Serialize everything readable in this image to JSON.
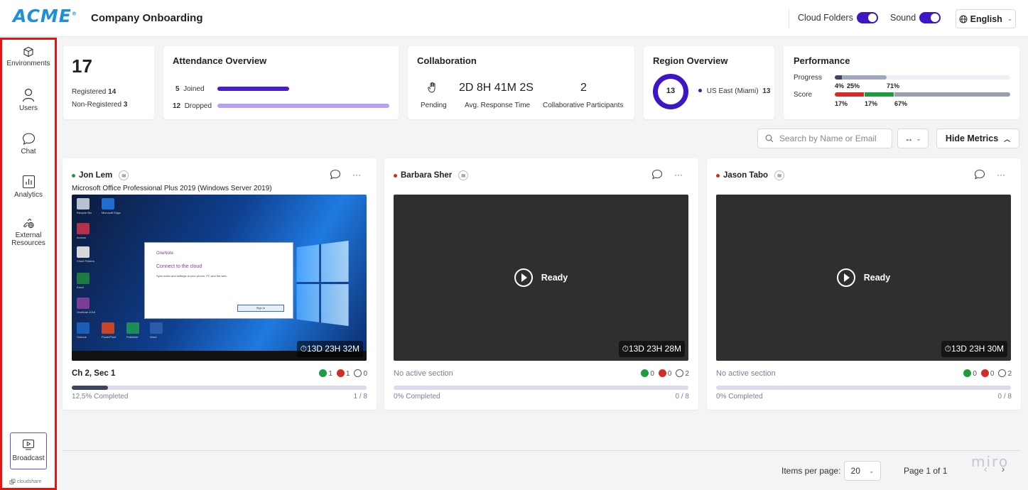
{
  "header": {
    "logo": "ACME",
    "logo_mark": "®",
    "title": "Company Onboarding",
    "cloud_folders_label": "Cloud Folders",
    "sound_label": "Sound",
    "language": "English",
    "accent_color": "#3d16c8"
  },
  "sidebar": {
    "items": [
      {
        "label": "Environments",
        "icon": "cube-icon"
      },
      {
        "label": "Users",
        "icon": "user-icon"
      },
      {
        "label": "Chat",
        "icon": "chat-bubble-icon"
      },
      {
        "label": "Analytics",
        "icon": "bar-chart-icon"
      },
      {
        "label": "External",
        "label2": "Resources",
        "icon": "link-globe-icon"
      }
    ],
    "broadcast_label": "Broadcast",
    "brand": "cloudshare",
    "highlight_color": "#e21515"
  },
  "metrics": {
    "total": "17",
    "registered_label": "Registered",
    "registered": "14",
    "non_registered_label": "Non-Registered",
    "non_registered": "3",
    "attendance": {
      "title": "Attendance Overview",
      "joined_count": "5",
      "joined_label": "Joined",
      "dropped_count": "12",
      "dropped_label": "Dropped"
    },
    "collaboration": {
      "title": "Collaboration",
      "pending_label": "Pending",
      "avg_response": "2D 8H 41M 2S",
      "avg_response_label": "Avg. Response Time",
      "participants": "2",
      "participants_label": "Collaborative Participants"
    },
    "region": {
      "title": "Region Overview",
      "total": "13",
      "region_name": "US East (Miami)",
      "region_count": "13"
    },
    "performance": {
      "title": "Performance",
      "progress_label": "Progress",
      "score_label": "Score",
      "progress_values": [
        "4%",
        "25%",
        "71%"
      ],
      "score_values": [
        "17%",
        "17%",
        "67%"
      ],
      "progress_fractions": [
        0.04,
        0.25,
        0.71
      ],
      "score_fractions": [
        0.17,
        0.17,
        0.67
      ]
    }
  },
  "toolbar": {
    "search_placeholder": "Search by Name or Email",
    "swap_label": "↔",
    "hide_metrics_label": "Hide Metrics"
  },
  "users": [
    {
      "name": "Jon Lem",
      "status_color": "#1f9c3f",
      "subtitle": "Microsoft Office Professional Plus 2019 (Windows Server 2019)",
      "screen": "desktop",
      "timer": "13D 23H 32M",
      "section": "Ch 2, Sec 1",
      "ok": "1",
      "err": "1",
      "pending": "0",
      "progress_label": "12.5% Completed",
      "progress_fraction": 0.125,
      "count": "1 / 8",
      "desktop": {
        "dialog_app": "OneNote",
        "dialog_title": "Connect to the cloud",
        "dialog_body": "Sync notes and settings to your phone, PC and the web.",
        "dialog_button": "Sign In",
        "icons": [
          "Recycle Bin",
          "Microsoft Edge",
          "Access",
          "Cloud Folders",
          "Excel",
          "OneNote 2016",
          "Outlook",
          "PowerPoint",
          "Publisher",
          "Word"
        ]
      }
    },
    {
      "name": "Barbara Sher",
      "status_color": "#d42a2a",
      "screen": "ready",
      "ready_label": "Ready",
      "timer": "13D 23H 28M",
      "section": "No active section",
      "ok": "0",
      "err": "0",
      "pending": "2",
      "progress_label": "0% Completed",
      "progress_fraction": 0,
      "count": "0 / 8"
    },
    {
      "name": "Jason Tabo",
      "status_color": "#d42a2a",
      "screen": "ready",
      "ready_label": "Ready",
      "timer": "13D 23H 30M",
      "section": "No active section",
      "ok": "0",
      "err": "0",
      "pending": "2",
      "progress_label": "0% Completed",
      "progress_fraction": 0,
      "count": "0 / 8"
    }
  ],
  "pagination": {
    "items_per_page_label": "Items per page:",
    "items_per_page": "20",
    "page_info": "Page 1 of 1"
  },
  "watermark": "miro"
}
